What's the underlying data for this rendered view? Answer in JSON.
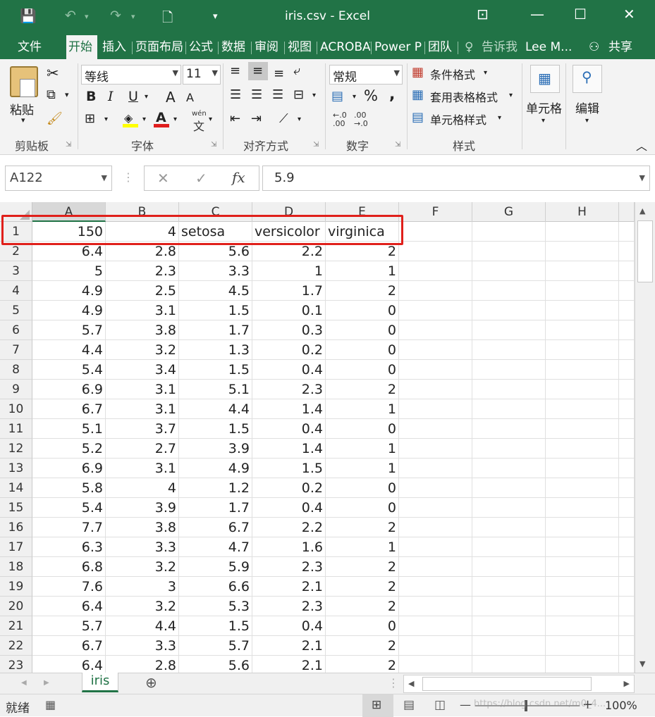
{
  "window": {
    "title": "iris.csv - Excel"
  },
  "quick_access": {
    "save": "💾",
    "undo": "↶",
    "redo": "↷",
    "new": "🗋",
    "customize": "▾"
  },
  "window_controls": {
    "restore_ribbon": "⊡",
    "minimize": "—",
    "maximize": "☐",
    "close": "✕"
  },
  "tabs": [
    "文件",
    "开始",
    "插入",
    "页面布局",
    "公式",
    "数据",
    "审阅",
    "视图",
    "ACROBAT",
    "Power P",
    "团队"
  ],
  "active_tab": "开始",
  "tell_me": "告诉我",
  "user": "Lee M...",
  "share": "共享",
  "ribbon": {
    "clipboard": {
      "label": "剪贴板",
      "paste": "粘贴"
    },
    "font": {
      "label": "字体",
      "name": "等线",
      "size": "11",
      "bold": "B",
      "italic": "I",
      "underline": "U",
      "grow": "A",
      "shrink": "A",
      "wen": "wén",
      "wen_char": "文"
    },
    "alignment": {
      "label": "对齐方式"
    },
    "number": {
      "label": "数字",
      "format": "常规",
      "percent": "%",
      "comma": ",",
      "inc": ".00",
      "dec": ".0"
    },
    "styles": {
      "label": "样式",
      "conditional": "条件格式",
      "table": "套用表格格式",
      "cell": "单元格样式"
    },
    "cells": {
      "label": "单元格"
    },
    "editing": {
      "label": "编辑"
    }
  },
  "formula_bar": {
    "name_box": "A122",
    "cancel": "✕",
    "enter": "✓",
    "fx": "fx",
    "value": "5.9"
  },
  "columns": [
    "A",
    "B",
    "C",
    "D",
    "E",
    "F",
    "G",
    "H"
  ],
  "selected_column": "A",
  "rows": [
    {
      "n": "1",
      "cells": [
        "150",
        "4",
        "setosa",
        "versicolor",
        "virginica"
      ]
    },
    {
      "n": "2",
      "cells": [
        "6.4",
        "2.8",
        "5.6",
        "2.2",
        "2"
      ]
    },
    {
      "n": "3",
      "cells": [
        "5",
        "2.3",
        "3.3",
        "1",
        "1"
      ]
    },
    {
      "n": "4",
      "cells": [
        "4.9",
        "2.5",
        "4.5",
        "1.7",
        "2"
      ]
    },
    {
      "n": "5",
      "cells": [
        "4.9",
        "3.1",
        "1.5",
        "0.1",
        "0"
      ]
    },
    {
      "n": "6",
      "cells": [
        "5.7",
        "3.8",
        "1.7",
        "0.3",
        "0"
      ]
    },
    {
      "n": "7",
      "cells": [
        "4.4",
        "3.2",
        "1.3",
        "0.2",
        "0"
      ]
    },
    {
      "n": "8",
      "cells": [
        "5.4",
        "3.4",
        "1.5",
        "0.4",
        "0"
      ]
    },
    {
      "n": "9",
      "cells": [
        "6.9",
        "3.1",
        "5.1",
        "2.3",
        "2"
      ]
    },
    {
      "n": "10",
      "cells": [
        "6.7",
        "3.1",
        "4.4",
        "1.4",
        "1"
      ]
    },
    {
      "n": "11",
      "cells": [
        "5.1",
        "3.7",
        "1.5",
        "0.4",
        "0"
      ]
    },
    {
      "n": "12",
      "cells": [
        "5.2",
        "2.7",
        "3.9",
        "1.4",
        "1"
      ]
    },
    {
      "n": "13",
      "cells": [
        "6.9",
        "3.1",
        "4.9",
        "1.5",
        "1"
      ]
    },
    {
      "n": "14",
      "cells": [
        "5.8",
        "4",
        "1.2",
        "0.2",
        "0"
      ]
    },
    {
      "n": "15",
      "cells": [
        "5.4",
        "3.9",
        "1.7",
        "0.4",
        "0"
      ]
    },
    {
      "n": "16",
      "cells": [
        "7.7",
        "3.8",
        "6.7",
        "2.2",
        "2"
      ]
    },
    {
      "n": "17",
      "cells": [
        "6.3",
        "3.3",
        "4.7",
        "1.6",
        "1"
      ]
    },
    {
      "n": "18",
      "cells": [
        "6.8",
        "3.2",
        "5.9",
        "2.3",
        "2"
      ]
    },
    {
      "n": "19",
      "cells": [
        "7.6",
        "3",
        "6.6",
        "2.1",
        "2"
      ]
    },
    {
      "n": "20",
      "cells": [
        "6.4",
        "3.2",
        "5.3",
        "2.3",
        "2"
      ]
    },
    {
      "n": "21",
      "cells": [
        "5.7",
        "4.4",
        "1.5",
        "0.4",
        "0"
      ]
    },
    {
      "n": "22",
      "cells": [
        "6.7",
        "3.3",
        "5.7",
        "2.1",
        "2"
      ]
    },
    {
      "n": "23",
      "cells": [
        "6.4",
        "2.8",
        "5.6",
        "2.1",
        "2"
      ]
    }
  ],
  "sheet_tabs": {
    "active": "iris",
    "add": "⊕",
    "prev": "◀",
    "next": "▶"
  },
  "status": {
    "ready": "就绪",
    "zoom": "100%",
    "minus": "—",
    "plus": "+"
  },
  "watermark": "https://blog.csdn.net/m0_4..."
}
